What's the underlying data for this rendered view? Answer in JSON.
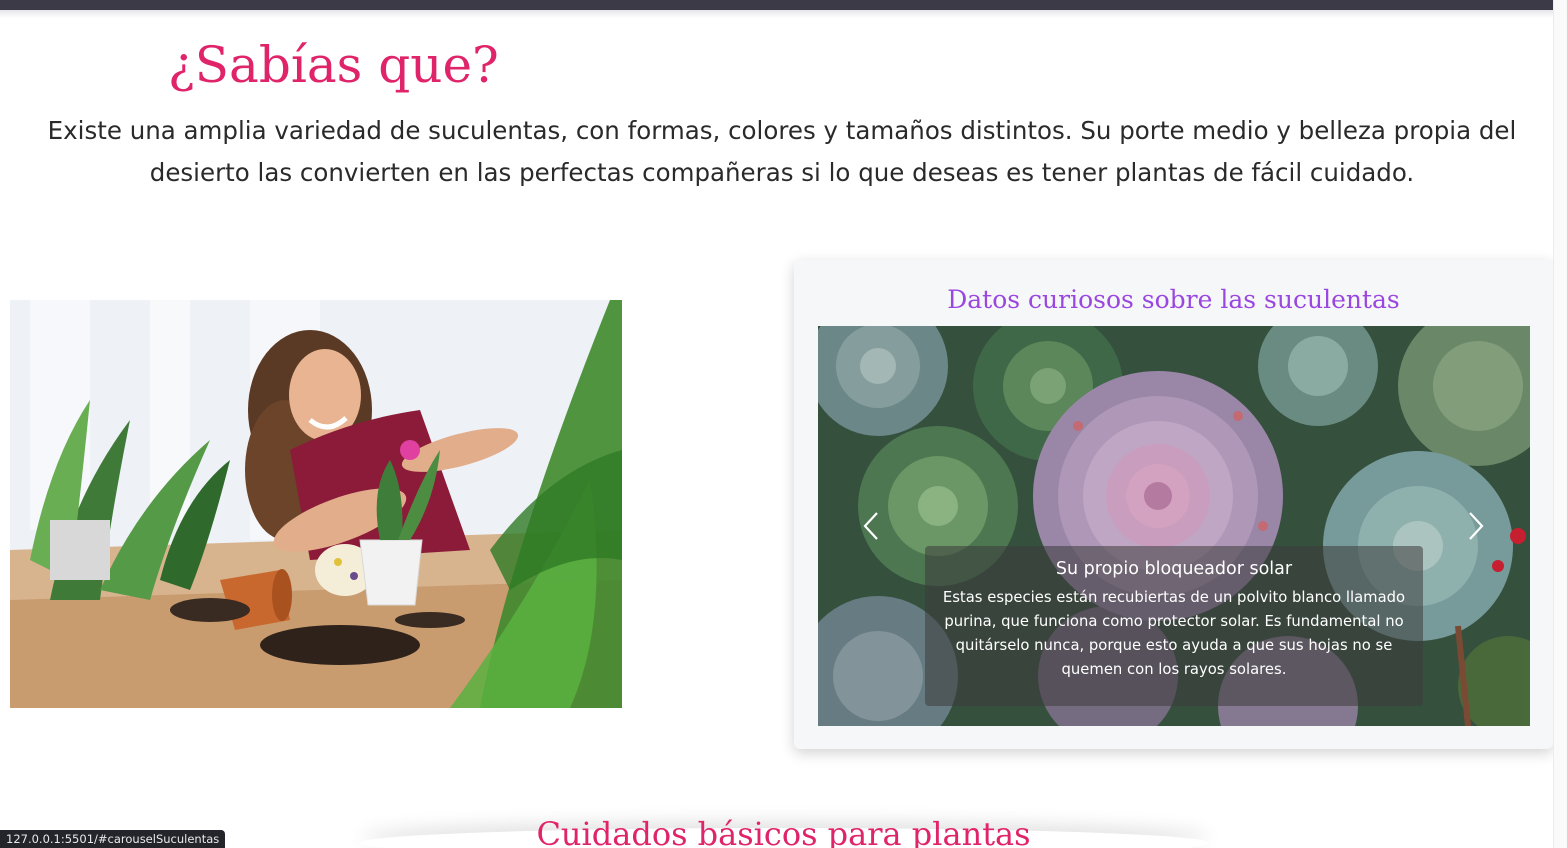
{
  "intro_section": {
    "title": "¿Sabías que?",
    "body": "Existe una amplia variedad de suculentas, con formas, colores y tamaños distintos. Su porte medio y belleza propia del desierto las convierten en las perfectas compañeras si lo que deseas es tener plantas de fácil cuidado."
  },
  "photo": {
    "description_icon": "woman-potting-plants-photo"
  },
  "facts_card": {
    "title": "Datos curiosos sobre las suculentas",
    "carousel": {
      "prev_icon": "chevron-left-icon",
      "next_icon": "chevron-right-icon",
      "active_slide": {
        "heading": "Su propio bloqueador solar",
        "text": "Estas especies están recubiertas de un polvito blanco llamado purina, que funciona como protector solar. Es fundamental no quitárselo nunca, porque esto ayuda a que sus hojas no se quemen con los rayos solares."
      }
    }
  },
  "next_section": {
    "title": "Cuidados básicos para plantas"
  },
  "status_bar": {
    "url": "127.0.0.1:5501/#carouselSuculentas"
  },
  "colors": {
    "accent_pink": "#e0246a",
    "accent_purple": "#9a47e0",
    "top_bar": "#3c3a46"
  }
}
